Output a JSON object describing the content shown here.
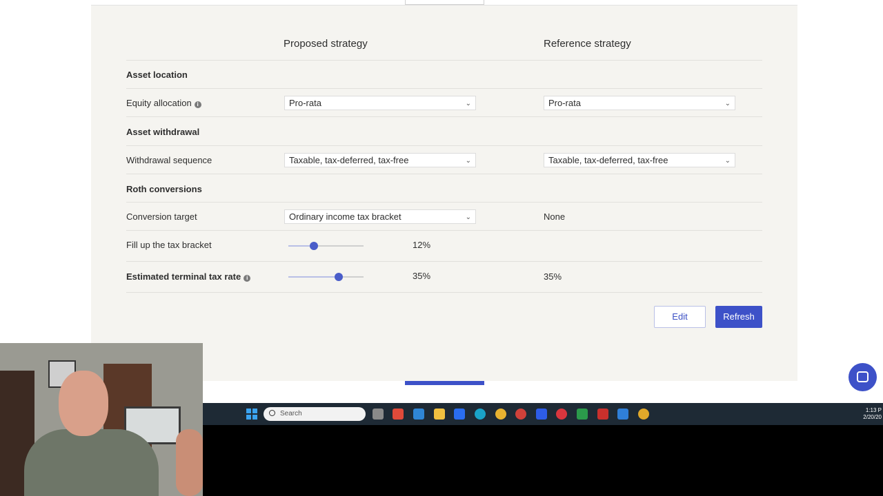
{
  "columns": {
    "proposed": "Proposed strategy",
    "reference": "Reference strategy"
  },
  "sections": {
    "asset_location": "Asset location",
    "asset_withdrawal": "Asset withdrawal",
    "roth_conversions": "Roth conversions"
  },
  "rows": {
    "equity_allocation": {
      "label": "Equity allocation",
      "proposed": "Pro-rata",
      "reference": "Pro-rata"
    },
    "withdrawal_sequence": {
      "label": "Withdrawal sequence",
      "proposed": "Taxable, tax-deferred, tax-free",
      "reference": "Taxable, tax-deferred, tax-free"
    },
    "conversion_target": {
      "label": "Conversion target",
      "proposed": "Ordinary income tax bracket",
      "reference": "None"
    },
    "fill_bracket": {
      "label": "Fill up the tax bracket",
      "proposed": "12%",
      "slider_level": 0.34
    },
    "terminal_tax": {
      "label": "Estimated terminal tax rate",
      "proposed": "35%",
      "reference": "35%",
      "slider_level": 0.67
    }
  },
  "buttons": {
    "edit": "Edit",
    "refresh": "Refresh"
  },
  "taskbar": {
    "search_placeholder": "Search",
    "time": "1:13 P",
    "date": "2/20/20"
  },
  "icons": {
    "info": "info-icon",
    "chevron": "chevron-down-icon",
    "chat": "chat-icon"
  },
  "colors": {
    "accent": "#3d51c8",
    "panel": "#f5f4f0"
  }
}
